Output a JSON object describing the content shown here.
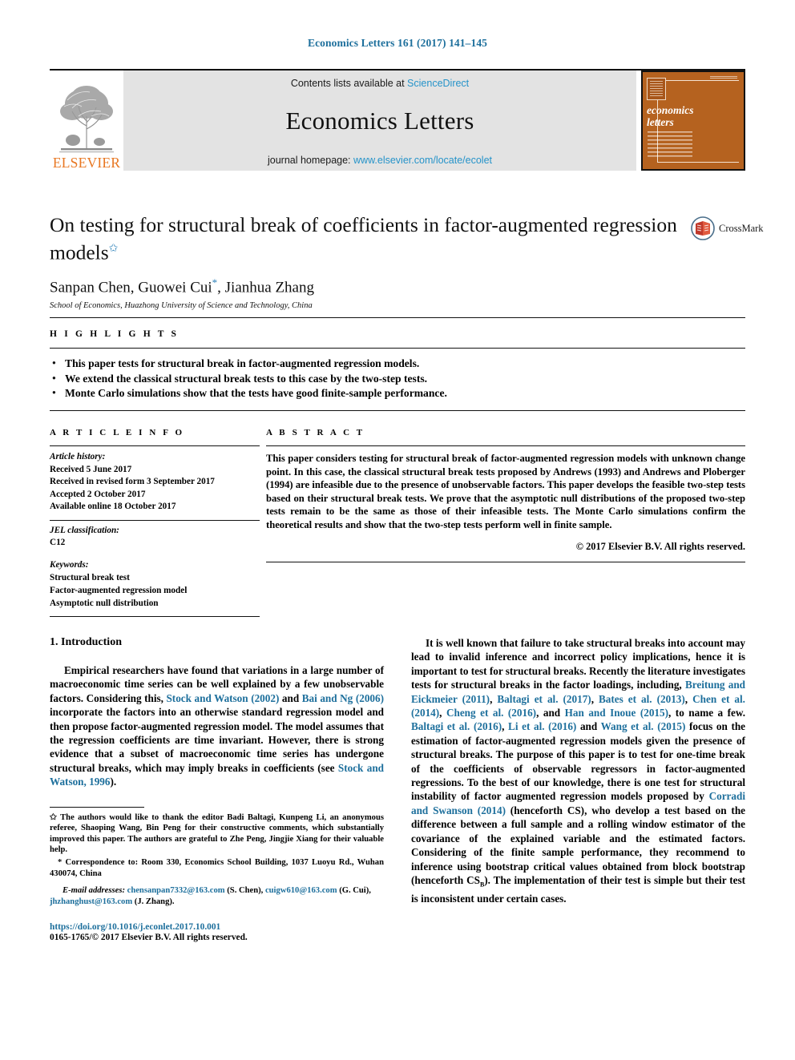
{
  "running_head": "Economics Letters 161 (2017) 141–145",
  "masthead": {
    "contents_prefix": "Contents lists available at ",
    "sciencedirect": "ScienceDirect",
    "journal_title": "Economics Letters",
    "homepage_prefix": "journal homepage: ",
    "homepage_url": "www.elsevier.com/locate/ecolet",
    "publisher_wordmark": "ELSEVIER",
    "cover_title": "economics\nletters",
    "cover_title_line1": "economics",
    "cover_title_line2": "letters"
  },
  "article": {
    "title": "On testing for structural break of coefficients in factor-augmented regression models",
    "title_footnote_mark": "✩",
    "authors": "Sanpan Chen, Guowei Cui",
    "authors_mark": "*",
    "authors_tail": ", Jianhua Zhang",
    "affiliation": "School of Economics, Huazhong University of Science and Technology, China",
    "crossmark_label": "CrossMark"
  },
  "highlights": {
    "heading": "H I G H L I G H T S",
    "items": [
      "This paper tests for structural break in factor-augmented regression models.",
      "We extend the classical structural break tests to this case by the two-step tests.",
      "Monte Carlo simulations show that the tests have good finite-sample performance."
    ]
  },
  "article_info": {
    "heading": "A R T I C L E    I N F O",
    "history_label": "Article history:",
    "history": [
      "Received 5 June 2017",
      "Received in revised form 3 September 2017",
      "Accepted 2 October 2017",
      "Available online 18 October 2017"
    ],
    "jel_label": "JEL classification:",
    "jel_value": "C12",
    "keywords_label": "Keywords:",
    "keywords": [
      "Structural break test",
      "Factor-augmented regression model",
      "Asymptotic null distribution"
    ]
  },
  "abstract": {
    "heading": "A B S T R A C T",
    "text": "This paper considers testing for structural break of factor-augmented regression models with unknown change point. In this case, the classical structural break tests proposed by Andrews (1993) and Andrews and Ploberger (1994) are infeasible due to the presence of unobservable factors. This paper develops the feasible two-step tests based on their structural break tests. We prove that the asymptotic null distributions of the proposed two-step tests remain to be the same as those of their infeasible tests. The Monte Carlo simulations confirm the theoretical results and show that the two-step tests perform well in finite sample.",
    "copyright": "© 2017 Elsevier B.V. All rights reserved."
  },
  "body": {
    "section_title": "1. Introduction",
    "left_paragraph": {
      "p1": "Empirical researchers have found that variations in a large number of macroeconomic time series can be well explained by a few unobservable factors. Considering this, ",
      "cit1": "Stock and Watson",
      "cit1_year": "(2002)",
      "p2": " and ",
      "cit2": "Bai and Ng",
      "cit2_year": "(2006)",
      "p3": " incorporate the factors into an otherwise standard regression model and then propose factor-augmented regression model. The model assumes that the regression coefficients are time invariant. However, there is strong evidence that a subset of macroeconomic time series has undergone structural breaks, which may imply breaks in coefficients (see ",
      "cit3": "Stock and Watson, 1996",
      "p4": ")."
    },
    "right_paragraph": {
      "p1": "It is well known that failure to take structural breaks into account may lead to invalid inference and incorrect policy implications, hence it is important to test for structural breaks. Recently the literature investigates tests for structural breaks in the factor loadings, including, ",
      "cit1": "Breitung and Eickmeier",
      "cit1_year": "(2011)",
      "sep1": ", ",
      "cit2": "Baltagi et al.",
      "cit2_year": "(2017)",
      "sep2": ", ",
      "cit3": "Bates et al.",
      "cit3_year": "(2013)",
      "sep3": ", ",
      "cit4": "Chen et al.",
      "cit4_year": "(2014)",
      "sep4": ", ",
      "cit5": "Cheng et al.",
      "cit5_year": "(2016)",
      "sep5": ", and ",
      "cit6": "Han and Inoue",
      "cit6_year": "(2015)",
      "p2": ", to name a few. ",
      "cit7": "Baltagi et al.",
      "cit7_year": "(2016)",
      "sep6": ", ",
      "cit8": "Li et al.",
      "cit8_year": "(2016)",
      "sep7": " and ",
      "cit9": "Wang et al.",
      "cit9_year": "(2015)",
      "p3": " focus on the estimation of factor-augmented regression models given the presence of structural breaks. The purpose of this paper is to test for one-time break of the coefficients of observable regressors in factor-augmented regressions. To the best of our knowledge, there is one test for structural instability of factor augmented regression models proposed by ",
      "cit10": "Corradi and Swanson",
      "cit10_year": "(2014)",
      "p4": " (henceforth CS), who develop a test based on the difference between a full sample and a rolling window estimator of the covariance of the explained variable and the estimated factors. Considering of the finite sample performance, they recommend to inference using bootstrap critical values obtained from block bootstrap (henceforth CS",
      "p4_sub": "B",
      "p5": "). The implementation of their test is simple but their test is inconsistent under certain cases."
    }
  },
  "footnotes": {
    "star_mark": "✩",
    "acknowledgement": " The authors would like to thank the editor Badi Baltagi, Kunpeng Li, an anonymous referee, Shaoping Wang, Bin Peng for their constructive comments, which substantially improved this paper. The authors are grateful to Zhe Peng, Jingjie Xiang for their valuable help.",
    "corr_mark": "*",
    "correspondence": " Correspondence to: Room 330, Economics School Building, 1037 Luoyu Rd., Wuhan 430074, China",
    "email_label": "E-mail addresses:",
    "emails": [
      {
        "address": "chensanpan7332@163.com",
        "person": " (S. Chen), "
      },
      {
        "address": "cuigw610@163.com",
        "person": " (G. Cui), "
      },
      {
        "address": "jhzhanghust@163.com",
        "person": " (J. Zhang)."
      }
    ],
    "doi": "https://doi.org/10.1016/j.econlet.2017.10.001",
    "issn_line": "0165-1765/© 2017 Elsevier B.V. All rights reserved."
  },
  "colors": {
    "link_blue": "#1d6f9c",
    "sciencedirect_blue": "#2593c9",
    "elsevier_orange": "#E87722",
    "cover_orange": "#b5621f",
    "banner_gray": "#e3e3e3"
  }
}
